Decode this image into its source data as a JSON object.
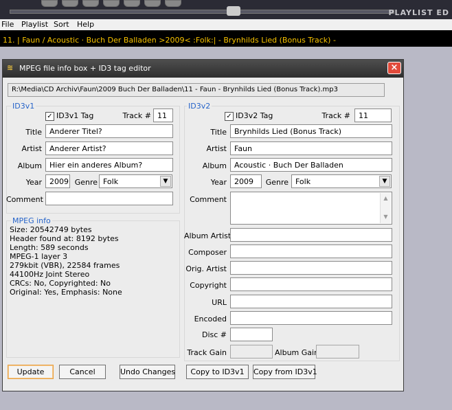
{
  "playlist_editor": {
    "title": "PLAYLIST ED",
    "now_playing": "11. | Faun / Acoustic · Buch Der Balladen >2009< :Folk:|    -    Brynhilds Lied (Bonus Track)  -"
  },
  "menu": {
    "file": "File",
    "playlist": "Playlist",
    "sort": "Sort",
    "help": "Help"
  },
  "dialog": {
    "title": "MPEG file info box + ID3 tag editor",
    "close_icon": "×",
    "path": "R:\\Media\\CD Archiv\\Faun\\2009 Buch Der Balladen\\11 - Faun - Brynhilds Lied (Bonus Track).mp3"
  },
  "id3v1": {
    "legend": "ID3v1",
    "tag_label": "ID3v1 Tag",
    "tag_checked": "✓",
    "track_label": "Track #",
    "track": "11",
    "title_label": "Title",
    "title": "Anderer Titel?",
    "artist_label": "Artist",
    "artist": "Anderer Artist?",
    "album_label": "Album",
    "album": "Hier ein anderes Album?",
    "year_label": "Year",
    "year": "2009",
    "genre_label": "Genre",
    "genre": "Folk",
    "comment_label": "Comment",
    "comment": ""
  },
  "mpeg_info": {
    "legend": "MPEG info",
    "lines": [
      "Size: 20542749 bytes",
      "Header found at: 8192 bytes",
      "Length: 589 seconds",
      "MPEG-1 layer 3",
      "279kbit (VBR), 22584 frames",
      "44100Hz Joint Stereo",
      "CRCs: No, Copyrighted: No",
      "Original: Yes, Emphasis: None"
    ]
  },
  "id3v2": {
    "legend": "ID3v2",
    "tag_label": "ID3v2 Tag",
    "tag_checked": "✓",
    "track_label": "Track #",
    "track": "11",
    "title_label": "Title",
    "title": "Brynhilds Lied (Bonus Track)",
    "artist_label": "Artist",
    "artist": "Faun",
    "album_label": "Album",
    "album": "Acoustic · Buch Der Balladen",
    "year_label": "Year",
    "year": "2009",
    "genre_label": "Genre",
    "genre": "Folk",
    "comment_label": "Comment",
    "comment": "",
    "album_artist_label": "Album Artist",
    "album_artist": "",
    "composer_label": "Composer",
    "composer": "",
    "orig_artist_label": "Orig. Artist",
    "orig_artist": "",
    "copyright_label": "Copyright",
    "copyright": "",
    "url_label": "URL",
    "url": "",
    "encoded_label": "Encoded",
    "encoded": "",
    "disc_label": "Disc #",
    "disc": "",
    "track_gain_label": "Track Gain",
    "track_gain": "",
    "album_gain_label": "Album Gain",
    "album_gain": ""
  },
  "buttons": {
    "update": "Update",
    "cancel": "Cancel",
    "undo": "Undo Changes",
    "copy_to_v1": "Copy to ID3v1",
    "copy_from_v1": "Copy from ID3v1"
  },
  "icons": {
    "dropdown": "▼",
    "scroll_up": "▲",
    "scroll_down": "▼",
    "title_icon": "≋"
  }
}
